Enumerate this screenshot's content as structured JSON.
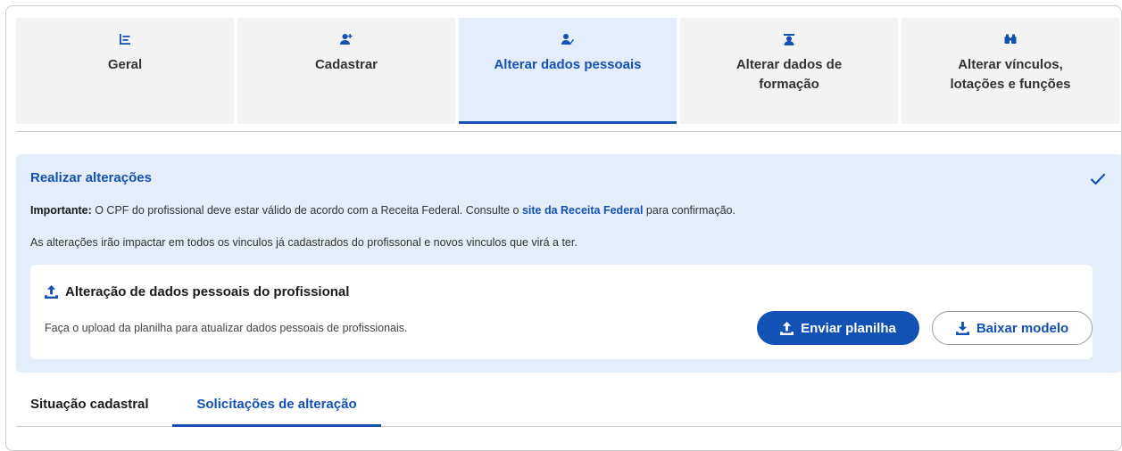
{
  "tabs": [
    {
      "label": "Geral",
      "icon": "chart-list-icon",
      "active": false
    },
    {
      "label": "Cadastrar",
      "icon": "user-plus-icon",
      "active": false
    },
    {
      "label": "Alterar dados pessoais",
      "icon": "user-edit-icon",
      "active": true
    },
    {
      "label": "Alterar dados de formação",
      "icon": "graduate-icon",
      "active": false
    },
    {
      "label": "Alterar vínculos, lotações e funções",
      "icon": "binoculars-icon",
      "active": false
    }
  ],
  "panel": {
    "title": "Realizar alterações",
    "important_label": "Importante:",
    "important_text_before": " O CPF do profissional deve estar válido de acordo com a Receita Federal. Consulte o ",
    "important_link": "site da Receita Federal",
    "important_text_after": " para confirmação.",
    "impact_text": "As alterações irão impactar em todos os vinculos já cadastrados do profissonal e novos vinculos que virá a ter."
  },
  "card": {
    "title": "Alteração de dados pessoais do profissional",
    "description": "Faça o upload da planilha para atualizar dados pessoais de profissionais.",
    "upload_button": "Enviar planilha",
    "download_button": "Baixar modelo"
  },
  "subtabs": [
    {
      "label": "Situação cadastral",
      "active": false
    },
    {
      "label": "Solicitações de alteração",
      "active": true
    }
  ],
  "colors": {
    "accent": "#1351b4",
    "panel_bg": "#e4eefb",
    "tab_bg": "#f3f3f3"
  }
}
